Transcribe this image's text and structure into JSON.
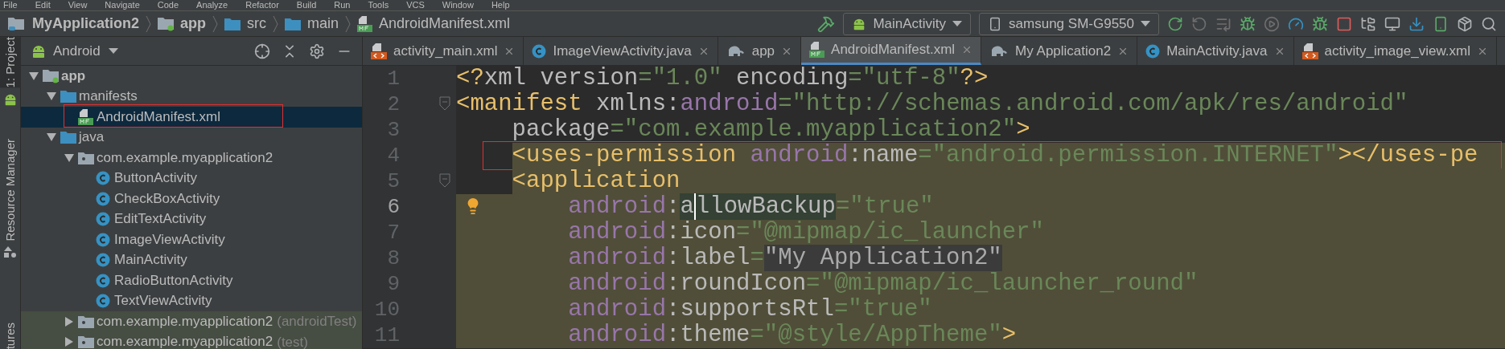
{
  "menu": [
    "File",
    "Edit",
    "View",
    "Navigate",
    "Code",
    "Analyze",
    "Refactor",
    "Build",
    "Run",
    "Tools",
    "VCS",
    "Window",
    "Help"
  ],
  "breadcrumbs": [
    {
      "label": "MyApplication2",
      "kind": "project",
      "bold": true
    },
    {
      "label": "app",
      "kind": "module",
      "bold": true
    },
    {
      "label": "src",
      "kind": "folder",
      "bold": false
    },
    {
      "label": "main",
      "kind": "folder",
      "bold": false
    },
    {
      "label": "AndroidManifest.xml",
      "kind": "manifest",
      "bold": false
    }
  ],
  "run_config": "MainActivity",
  "device": "samsung SM-G9550",
  "side_strip": [
    {
      "label": "1: Project",
      "selected": true
    },
    {
      "label": "Resource Manager",
      "selected": false
    },
    {
      "label": "tures",
      "selected": false
    }
  ],
  "project_view": "Android",
  "tree": [
    {
      "label": "app",
      "kind": "module",
      "bold": true,
      "expanded": true,
      "children": [
        {
          "label": "manifests",
          "kind": "folder",
          "expanded": true,
          "children": [
            {
              "label": "AndroidManifest.xml",
              "kind": "manifest",
              "selected": true
            }
          ]
        },
        {
          "label": "java",
          "kind": "folder",
          "expanded": true,
          "children": [
            {
              "label": "com.example.myapplication2",
              "kind": "package",
              "expanded": true,
              "children": [
                {
                  "label": "ButtonActivity",
                  "kind": "class",
                  "selected": false
                },
                {
                  "label": "CheckBoxActivity",
                  "kind": "class",
                  "selected": false
                },
                {
                  "label": "EditTextActivity",
                  "kind": "class",
                  "selected": false
                },
                {
                  "label": "ImageViewActivity",
                  "kind": "class",
                  "selected": false
                },
                {
                  "label": "MainActivity",
                  "kind": "class",
                  "selected": false
                },
                {
                  "label": "RadioButtonActivity",
                  "kind": "class",
                  "selected": false
                },
                {
                  "label": "TextViewActivity",
                  "kind": "class",
                  "selected": false
                }
              ]
            },
            {
              "label": "com.example.myapplication2",
              "suffix": "(androidTest)",
              "kind": "package",
              "expanded": false,
              "tinted": true
            },
            {
              "label": "com.example.myapplication2",
              "suffix": "(test)",
              "kind": "package",
              "expanded": false,
              "tinted": true
            }
          ]
        }
      ]
    }
  ],
  "tabs": [
    {
      "label": "activity_main.xml",
      "kind": "xml",
      "selected": false
    },
    {
      "label": "ImageViewActivity.java",
      "kind": "class",
      "selected": false
    },
    {
      "label": "app",
      "kind": "gradle",
      "selected": false
    },
    {
      "label": "AndroidManifest.xml",
      "kind": "manifest",
      "selected": true
    },
    {
      "label": "My Application2",
      "kind": "gradle",
      "selected": false
    },
    {
      "label": "MainActivity.java",
      "kind": "class",
      "selected": false
    },
    {
      "label": "activity_image_view.xml",
      "kind": "xml",
      "selected": false
    }
  ],
  "lines": [
    {
      "number": "1",
      "kind": "root",
      "highlighted": false,
      "tokens": [
        {
          "text": "<?",
          "kind": "tag"
        },
        {
          "text": "xml version",
          "kind": "attr"
        },
        {
          "text": "=\"1.0\"",
          "kind": "value"
        },
        {
          "text": " encoding",
          "kind": "attr"
        },
        {
          "text": "=\"utf-8\"",
          "kind": "value"
        },
        {
          "text": "?>",
          "kind": "tag"
        }
      ]
    },
    {
      "number": "2",
      "kind": "root",
      "highlighted": false,
      "fold": true,
      "tokens": [
        {
          "text": "<manifest",
          "kind": "tag"
        },
        {
          "text": " xmlns:",
          "kind": "attr"
        },
        {
          "text": "android",
          "kind": "ns"
        },
        {
          "text": "=\"http://schemas.android.com/apk/res/android\"",
          "kind": "value"
        }
      ]
    },
    {
      "number": "3",
      "kind": "child",
      "highlighted": false,
      "tokens": [
        {
          "text": "package",
          "kind": "attr"
        },
        {
          "text": "=\"com.example.myapplication2\"",
          "kind": "value"
        },
        {
          "text": ">",
          "kind": "tag"
        }
      ]
    },
    {
      "number": "4",
      "kind": "child",
      "highlighted": true,
      "annotated": true,
      "tokens": [
        {
          "text": "<uses-permission",
          "kind": "tag"
        },
        {
          "text": " android",
          "kind": "ns"
        },
        {
          "text": ":name",
          "kind": "attr"
        },
        {
          "text": "=\"android.permission.INTERNET\"",
          "kind": "value"
        },
        {
          "text": "></uses-pe",
          "kind": "tag"
        }
      ]
    },
    {
      "number": "5",
      "kind": "child",
      "highlighted": true,
      "fold": true,
      "tokens": [
        {
          "text": "<application",
          "kind": "tag"
        }
      ]
    },
    {
      "number": "6",
      "kind": "attribute",
      "highlighted": true,
      "current": true,
      "bulb": true,
      "tokens": [
        {
          "text": "android",
          "kind": "ns"
        },
        {
          "text": ":",
          "kind": "attr"
        },
        {
          "text": "a",
          "kind": "attr",
          "marked": true
        },
        {
          "text": "llowBackup",
          "kind": "attr",
          "marked": true,
          "caret": true
        },
        {
          "text": "=\"true\"",
          "kind": "value"
        }
      ]
    },
    {
      "number": "7",
      "kind": "attribute",
      "highlighted": true,
      "tokens": [
        {
          "text": "android",
          "kind": "ns"
        },
        {
          "text": ":icon",
          "kind": "attr"
        },
        {
          "text": "=\"@mipmap/ic_launcher\"",
          "kind": "value"
        }
      ]
    },
    {
      "number": "8",
      "kind": "attribute",
      "highlighted": true,
      "tokens": [
        {
          "text": "android",
          "kind": "ns"
        },
        {
          "text": ":label",
          "kind": "attr"
        },
        {
          "text": "=",
          "kind": "value"
        },
        {
          "text": "\"My Application2\"",
          "kind": "value",
          "marked": true
        }
      ]
    },
    {
      "number": "9",
      "kind": "attribute",
      "highlighted": true,
      "tokens": [
        {
          "text": "android",
          "kind": "ns"
        },
        {
          "text": ":roundIcon",
          "kind": "attr"
        },
        {
          "text": "=\"@mipmap/ic_launcher_round\"",
          "kind": "value"
        }
      ]
    },
    {
      "number": "10",
      "kind": "attribute",
      "highlighted": true,
      "tokens": [
        {
          "text": "android",
          "kind": "ns"
        },
        {
          "text": ":supportsRtl",
          "kind": "attr"
        },
        {
          "text": "=\"true\"",
          "kind": "value"
        }
      ]
    },
    {
      "number": "11",
      "kind": "attribute",
      "highlighted": true,
      "tokens": [
        {
          "text": "android",
          "kind": "ns"
        },
        {
          "text": ":theme",
          "kind": "attr"
        },
        {
          "text": "=\"@style/AppTheme\"",
          "kind": "value"
        },
        {
          "text": ">",
          "kind": "tag"
        }
      ]
    }
  ]
}
